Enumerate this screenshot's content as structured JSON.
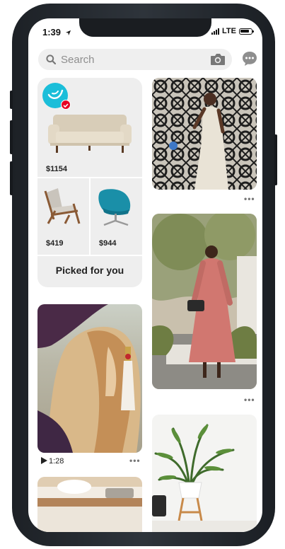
{
  "status": {
    "time": "1:39",
    "network": "LTE"
  },
  "search": {
    "placeholder": "Search"
  },
  "shopping": {
    "prices": [
      "$1154",
      "$419",
      "$944"
    ],
    "label": "Picked for you"
  },
  "feed": {
    "video_duration": "1:28",
    "more": "•••"
  },
  "colors": {
    "brand_badge": "#1bbed9",
    "verified": "#e60023",
    "chair_teal": "#1a8fa8"
  }
}
